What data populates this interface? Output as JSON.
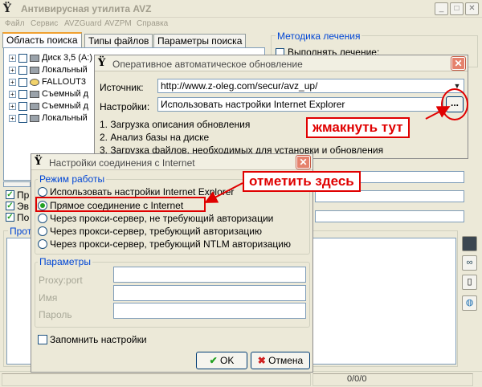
{
  "main": {
    "title": "Антивирусная утилита AVZ",
    "menu": [
      "Файл",
      "Сервис",
      "AVZGuard",
      "AVZPM",
      "Справка"
    ],
    "tabs": [
      "Область поиска",
      "Типы файлов",
      "Параметры поиска"
    ],
    "tree": [
      "Диск 3,5 (A:)",
      "Локальный",
      "FALLOUT3",
      "Съемный д",
      "Съемный д",
      "Локальный"
    ],
    "checks": [
      "Пр",
      "Эв",
      "По"
    ],
    "method_title": "Методика лечения",
    "method_option": "Выполнять лечение:",
    "log_title": "Прот",
    "status_counter": "0/0/0"
  },
  "update_dialog": {
    "title": "Оперативное автоматическое обновление",
    "source_label": "Источник:",
    "source_value": "http://www.z-oleg.com/secur/avz_up/",
    "settings_label": "Настройки:",
    "settings_value": "Использовать настройки Internet Explorer",
    "browse_label": "...",
    "steps": [
      "1. Загрузка описания обновления",
      "2. Анализ базы на диске",
      "3. Загрузка файлов, необходимых для установки и обновления"
    ]
  },
  "conn_dialog": {
    "title": "Настройки соединения с Internet",
    "mode_title": "Режим работы",
    "modes": [
      "Использовать настройки Internet Explorer",
      "Прямое соединение с Internet",
      "Через прокси-сервер, не требующий авторизации",
      "Через прокси-сервер, требующий авторизацию",
      "Через прокси-сервер, требующий NTLM авторизацию"
    ],
    "selected_mode": 1,
    "params_title": "Параметры",
    "param_labels": [
      "Proxy:port",
      "Имя",
      "Пароль"
    ],
    "remember_label": "Запомнить настройки",
    "ok_label": "OK",
    "cancel_label": "Отмена"
  },
  "annotations": {
    "click_here": "жмакнуть тут",
    "mark_here": "отметить здесь"
  },
  "colors": {
    "annotation": "#e00000",
    "group_title": "#0046d5",
    "ok_check": "#21a121",
    "cancel_x": "#d02020"
  }
}
